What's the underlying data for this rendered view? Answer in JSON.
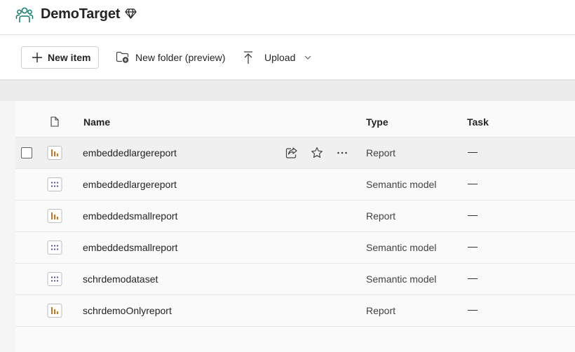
{
  "workspace": {
    "title": "DemoTarget",
    "icon": "people-workspace-icon",
    "badge_icon": "diamond-icon"
  },
  "toolbar": {
    "new_item_label": "New item",
    "new_folder_label": "New folder (preview)",
    "upload_label": "Upload"
  },
  "table": {
    "columns": {
      "name": "Name",
      "type": "Type",
      "task": "Task"
    },
    "rows": [
      {
        "name": "embeddedlargereport",
        "type": "Report",
        "task": "—",
        "icon": "report-icon"
      },
      {
        "name": "embeddedlargereport",
        "type": "Semantic model",
        "task": "—",
        "icon": "semantic-model-icon"
      },
      {
        "name": "embeddedsmallreport",
        "type": "Report",
        "task": "—",
        "icon": "report-icon"
      },
      {
        "name": "embeddedsmallreport",
        "type": "Semantic model",
        "task": "—",
        "icon": "semantic-model-icon"
      },
      {
        "name": "schrdemodataset",
        "type": "Semantic model",
        "task": "—",
        "icon": "semantic-model-icon"
      },
      {
        "name": "schrdemoOnlyreport",
        "type": "Report",
        "task": "—",
        "icon": "report-icon"
      }
    ]
  },
  "colors": {
    "accent_teal": "#0f7b6c",
    "report_orange": "#c7771f",
    "model_purple": "#5c3d99"
  }
}
